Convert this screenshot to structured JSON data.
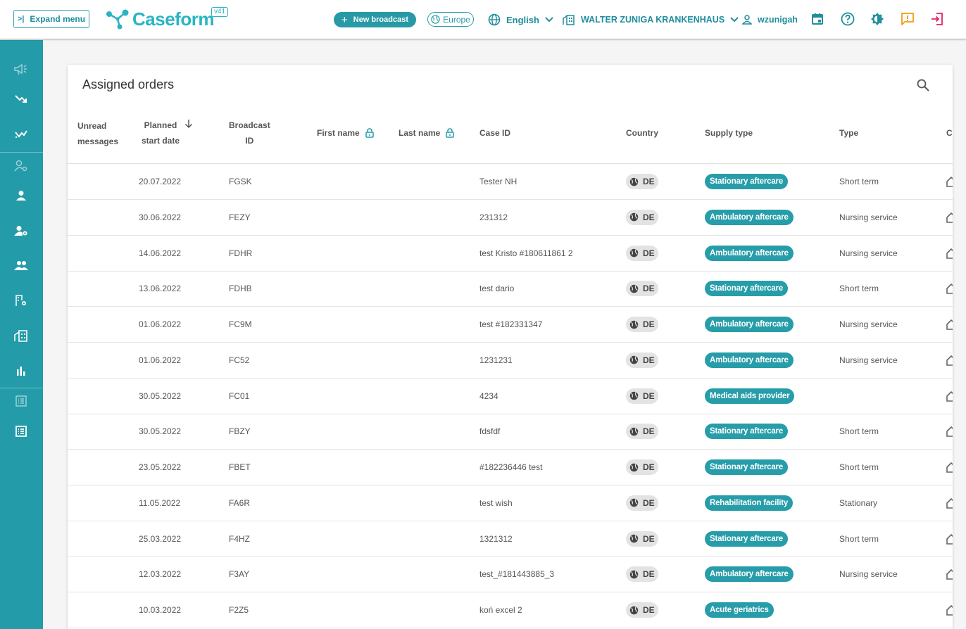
{
  "header": {
    "expand_menu": "Expand menu",
    "logo": "Caseform",
    "version": "v41",
    "new_broadcast": "New broadcast",
    "region": "Europe",
    "language": "English",
    "hospital": "WALTER ZUNIGA KRANKENHAUS",
    "username": "wzunigah"
  },
  "icons": {
    "calendar": "calendar-icon",
    "help": "help-icon",
    "theme": "brightness-icon",
    "feedback": "feedback-icon",
    "logout": "logout-icon"
  },
  "colors": {
    "brand": "#249ba9",
    "accent": "#2ab4c3",
    "feedback": "#f39c12",
    "logout": "#e0245e"
  },
  "main": {
    "title": "Assigned orders",
    "columns": {
      "unread_1": "Unread",
      "unread_2": "messages",
      "planned_1": "Planned",
      "planned_2": "start date",
      "broadcast_1": "Broadcast",
      "broadcast_2": "ID",
      "first_name": "First name",
      "last_name": "Last name",
      "case_id": "Case ID",
      "country": "Country",
      "supply_type": "Supply type",
      "type": "Type",
      "clipped": "C"
    },
    "rows": [
      {
        "date": "20.07.2022",
        "broadcast": "FGSK",
        "case": "Tester NH",
        "country": "DE",
        "supply": "Stationary aftercare",
        "type": "Short term"
      },
      {
        "date": "30.06.2022",
        "broadcast": "FEZY",
        "case": "231312",
        "country": "DE",
        "supply": "Ambulatory aftercare",
        "type": "Nursing service"
      },
      {
        "date": "14.06.2022",
        "broadcast": "FDHR",
        "case": "test Kristo #180611861 2",
        "country": "DE",
        "supply": "Ambulatory aftercare",
        "type": "Nursing service"
      },
      {
        "date": "13.06.2022",
        "broadcast": "FDHB",
        "case": "test dario",
        "country": "DE",
        "supply": "Stationary aftercare",
        "type": "Short term"
      },
      {
        "date": "01.06.2022",
        "broadcast": "FC9M",
        "case": "test #182331347",
        "country": "DE",
        "supply": "Ambulatory aftercare",
        "type": "Nursing service"
      },
      {
        "date": "01.06.2022",
        "broadcast": "FC52",
        "case": "1231231",
        "country": "DE",
        "supply": "Ambulatory aftercare",
        "type": "Nursing service"
      },
      {
        "date": "30.05.2022",
        "broadcast": "FC01",
        "case": "4234",
        "country": "DE",
        "supply": "Medical aids provider",
        "type": ""
      },
      {
        "date": "30.05.2022",
        "broadcast": "FBZY",
        "case": "fdsfdf",
        "country": "DE",
        "supply": "Stationary aftercare",
        "type": "Short term"
      },
      {
        "date": "23.05.2022",
        "broadcast": "FBET",
        "case": "#182236446 test",
        "country": "DE",
        "supply": "Stationary aftercare",
        "type": "Short term"
      },
      {
        "date": "11.05.2022",
        "broadcast": "FA6R",
        "case": "test wish",
        "country": "DE",
        "supply": "Rehabilitation facility",
        "type": "Stationary"
      },
      {
        "date": "25.03.2022",
        "broadcast": "F4HZ",
        "case": "1321312",
        "country": "DE",
        "supply": "Stationary aftercare",
        "type": "Short term"
      },
      {
        "date": "12.03.2022",
        "broadcast": "F3AY",
        "case": "test_#181443885_3",
        "country": "DE",
        "supply": "Ambulatory aftercare",
        "type": "Nursing service"
      },
      {
        "date": "10.03.2022",
        "broadcast": "F2Z5",
        "case": "koń excel 2",
        "country": "DE",
        "supply": "Acute geriatrics",
        "type": ""
      }
    ]
  }
}
